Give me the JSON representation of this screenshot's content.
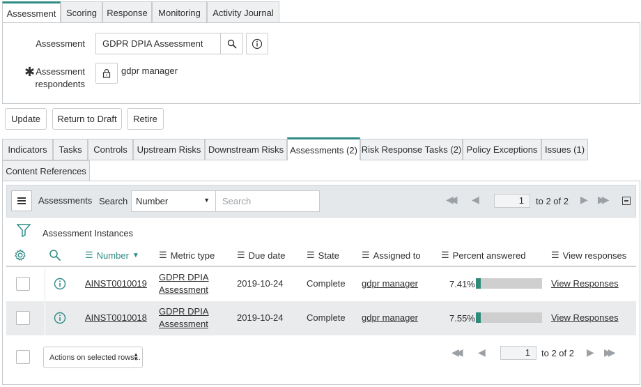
{
  "top_tabs": [
    "Assessment",
    "Scoring",
    "Response",
    "Monitoring",
    "Activity Journal"
  ],
  "form": {
    "assessment_label": "Assessment",
    "assessment_value": "GDPR DPIA Assessment",
    "respondents_label_1": "Assessment",
    "respondents_label_2": "respondents",
    "required_mark": "✱",
    "respondents_value": "gdpr manager"
  },
  "buttons": {
    "update": "Update",
    "return_to_draft": "Return to Draft",
    "retire": "Retire"
  },
  "related_tabs": [
    "Indicators",
    "Tasks",
    "Controls",
    "Upstream Risks",
    "Downstream Risks",
    "Assessments (2)",
    "Risk Response Tasks (2)",
    "Policy Exceptions",
    "Issues (1)",
    "Content References"
  ],
  "list": {
    "title": "Assessments",
    "search_label": "Search",
    "search_field": "Number",
    "search_placeholder": "Search",
    "page": "1",
    "page_range": "to 2 of 2",
    "breadcrumb": "Assessment Instances",
    "columns": [
      "Number",
      "Metric type",
      "Due date",
      "State",
      "Assigned to",
      "Percent answered",
      "View responses"
    ],
    "rows": [
      {
        "number": "AINST0010019",
        "metric_line1": "GDPR DPIA",
        "metric_line2": "Assessment",
        "due": "2019-10-24",
        "state": "Complete",
        "assigned": "gdpr manager",
        "percent_text": "7.41%",
        "percent": 7.41,
        "view": "View Responses"
      },
      {
        "number": "AINST0010018",
        "metric_line1": "GDPR DPIA",
        "metric_line2": "Assessment",
        "due": "2019-10-24",
        "state": "Complete",
        "assigned": "gdpr manager",
        "percent_text": "7.55%",
        "percent": 7.55,
        "view": "View Responses"
      }
    ],
    "actions_select": "Actions on selected rows...",
    "footer_page": "1",
    "footer_range": "to 2 of 2"
  },
  "colors": {
    "accent": "#2e8b86",
    "progress_fill": "#2e8b7a",
    "progress_track": "#cfcfcf"
  }
}
